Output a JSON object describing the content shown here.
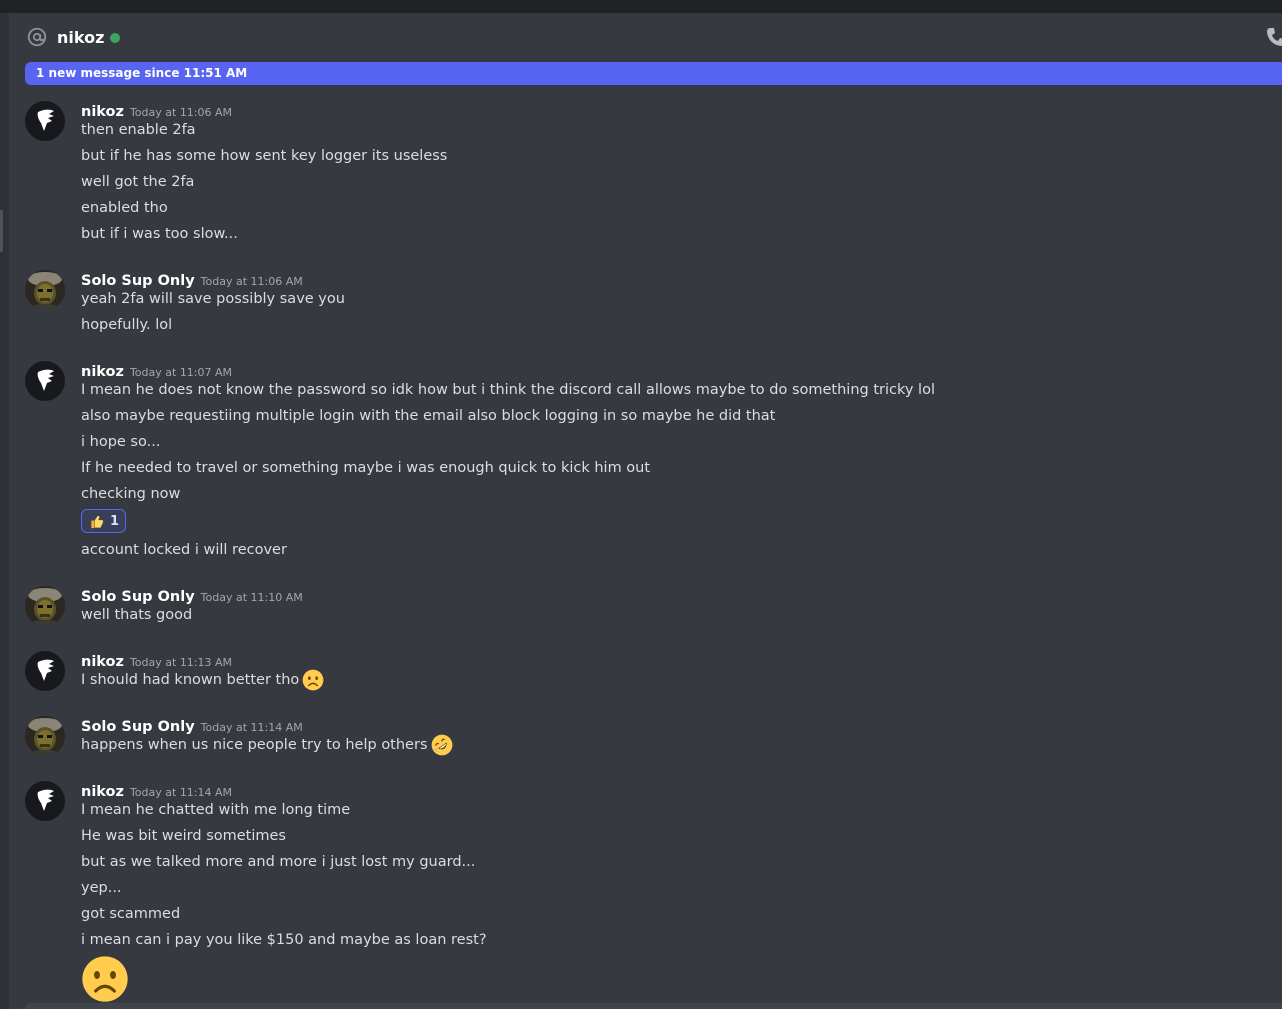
{
  "header": {
    "channel_name": "nikoz",
    "status": "online"
  },
  "new_messages_bar": "1 new message since 11:51 AM",
  "groups": [
    {
      "author": "nikoz",
      "timestamp": "Today at 11:06 AM",
      "messages": [
        "then enable 2fa",
        "but if he has some how sent key logger its useless",
        "well got the 2fa",
        "enabled tho",
        "but if i was too slow..."
      ]
    },
    {
      "author": "Solo Sup Only",
      "timestamp": "Today at 11:06 AM",
      "messages": [
        "yeah 2fa will save possibly save you",
        "hopefully. lol"
      ]
    },
    {
      "author": "nikoz",
      "timestamp": "Today at 11:07 AM",
      "messages": [
        "I mean he does not know the password so idk how but i think the discord call allows maybe to do something tricky lol",
        "also maybe requestiing multiple login with the email also block logging in so maybe he did that",
        "i hope so...",
        "If he needed to travel or something maybe i was enough quick to kick him out",
        "checking now",
        "account locked i will recover"
      ],
      "reaction": {
        "emoji": "thumbs-up",
        "count": "1"
      }
    },
    {
      "author": "Solo Sup Only",
      "timestamp": "Today at 11:10 AM",
      "messages": [
        "well thats good"
      ]
    },
    {
      "author": "nikoz",
      "timestamp": "Today at 11:13 AM",
      "messages": [
        "I should had known better tho"
      ],
      "inline_emoji": "frowning-face"
    },
    {
      "author": "Solo Sup Only",
      "timestamp": "Today at 11:14 AM",
      "messages": [
        "happens when us nice people try to help others"
      ],
      "inline_emoji": "rolling-on-floor-laughing"
    },
    {
      "author": "nikoz",
      "timestamp": "Today at 11:14 AM",
      "messages": [
        "I mean he chatted with me long time",
        "He was bit weird sometimes",
        "but as we talked more and more i just lost my guard...",
        "yep...",
        "got scammed",
        "i mean can i pay you like $150 and maybe as loan rest?"
      ],
      "big_emoji": "frowning-face"
    }
  ],
  "colors": {
    "background": "#36393f",
    "accent": "#5865f2",
    "online": "#3ba55d",
    "username": "#ffffff",
    "text": "#dcddde",
    "timestamp": "#a3a6aa"
  }
}
